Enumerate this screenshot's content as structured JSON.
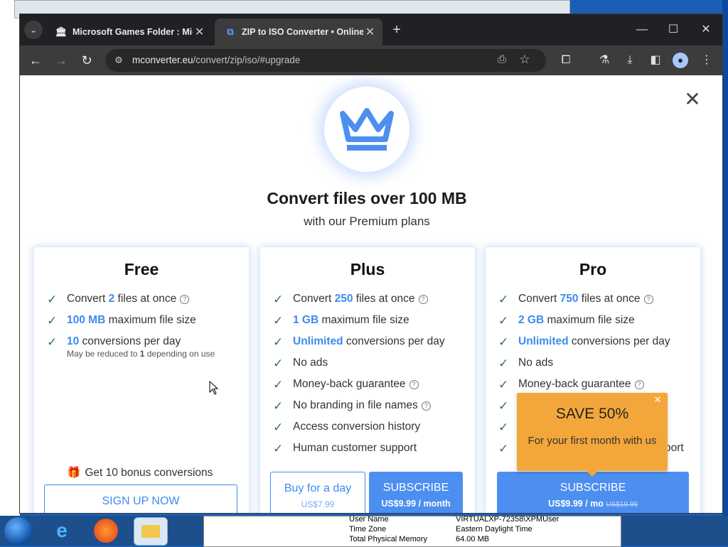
{
  "browser": {
    "tabs": [
      {
        "label": "Microsoft Games Folder : Micr",
        "icon": "columns-icon"
      },
      {
        "label": "ZIP to ISO Converter • Online (",
        "icon": "converter-icon",
        "active": true
      }
    ],
    "url_host": "mconverter.eu",
    "url_path": "/convert/zip/iso/#upgrade"
  },
  "modal": {
    "headline": "Convert files over 100 MB",
    "subheadline": "with our Premium plans",
    "accent_color": "#4d8ff0",
    "plans": {
      "free": {
        "title": "Free",
        "f1_pre": "Convert ",
        "f1_hl": "2",
        "f1_post": " files at once",
        "f2_hl": "100 MB",
        "f2_post": " maximum file size",
        "f3_hl": "10",
        "f3_post": " conversions per day",
        "note_pre": "May be reduced to ",
        "note_hl": "1",
        "note_post": " depending on use",
        "bonus": "Get 10 bonus conversions",
        "signup": "SIGN UP NOW"
      },
      "plus": {
        "title": "Plus",
        "f1_pre": "Convert ",
        "f1_hl": "250",
        "f1_post": " files at once",
        "f2_hl": "1 GB",
        "f2_post": " maximum file size",
        "f3_hl": "Unlimited",
        "f3_post": " conversions per day",
        "f4": "No ads",
        "f5": "Money-back guarantee",
        "f6": "No branding in file names",
        "f7": "Access conversion history",
        "f8": "Human customer support",
        "buy_day": "Buy for a day",
        "buy_day_price": "US$7.99",
        "subscribe": "SUBSCRIBE",
        "subscribe_price": "US$9.99 / month"
      },
      "pro": {
        "title": "Pro",
        "f1_pre": "Convert ",
        "f1_hl": "750",
        "f1_post": " files at once",
        "f2_hl": "2 GB",
        "f2_post": " maximum file size",
        "f3_hl": "Unlimited",
        "f3_post": " conversions per day",
        "f4": "No ads",
        "f5": "Money-back guarantee",
        "f8_tail": "port",
        "subscribe": "SUBSCRIBE",
        "subscribe_price": "US$9.99 / mo",
        "subscribe_old_price": "US$19.99"
      }
    },
    "popup": {
      "title": "SAVE 50%",
      "text": "For your first month with us"
    }
  },
  "sysinfo": {
    "rows": [
      {
        "k": "User Name",
        "v": "VIRTUALXP-72358\\XPMUser"
      },
      {
        "k": "Time Zone",
        "v": "Eastern Daylight Time"
      },
      {
        "k": "Total Physical Memory",
        "v": "64.00 MB"
      }
    ]
  }
}
